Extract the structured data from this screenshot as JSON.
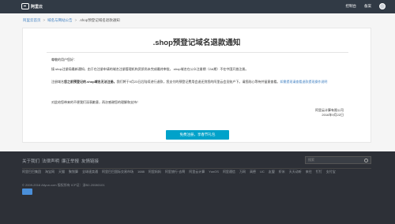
{
  "topbar": {
    "brand": "阿里云",
    "nav": [
      "控制台",
      "备案"
    ]
  },
  "breadcrumb": {
    "items": [
      "阿里云首页",
      "域名与网站公告",
      ".shop预登记域名退款通知"
    ],
    "separator": ">"
  },
  "notice": {
    "title": ".shop预登记域名退款通知",
    "greeting": "尊敬的用户您好：",
    "para1": "接.shop注册局最新通知，由于在注册申请的域名注册管理机构资质尚未完成最终审批，.shop域名在公众注册期（GA期）不在中国开放注册。",
    "para2_prefix": "注册域名",
    "para2_bold": "您之前预登记的.shop域名无法注册。",
    "para2_body": "我们将于9月23日后陆续进行退款，您支付的预登记费用会退还到您的阿里云会员账户下。请您耐心等待并留意查看。",
    "para2_link": "如需提现请查看退款提现操作说明",
    "para3": "对此给您带来的不便我们深表歉意，再次感谢您的理解和支持！",
    "sign_org": "阿里云计算有限公司",
    "sign_date": "2016年9月22日"
  },
  "cta": {
    "label": "免费注册，享春节礼包"
  },
  "footer": {
    "links": [
      "关于我们",
      "法律声明",
      "廉正举报",
      "友情链接"
    ],
    "search_placeholder": "搜索",
    "sites": [
      "阿里巴巴集团",
      "淘宝网",
      "天猫",
      "聚划算",
      "全球速卖通",
      "阿里巴巴国际交易市场",
      "1688",
      "阿里妈妈",
      "阿里旅行·去啊",
      "阿里云计算",
      "YunOS",
      "阿里通信",
      "万网",
      "高德",
      "UC",
      "友盟",
      "虾米",
      "天天动听",
      "来往",
      "钉钉",
      "支付宝"
    ],
    "copyright": "© 2009-2016 Aliyun.com 版权所有 ICP证：浙B2-20080101"
  },
  "colors": {
    "topbar": "#313a45",
    "accent": "#00a2ca",
    "link": "#3e7fc1",
    "footer": "#2d3037"
  }
}
